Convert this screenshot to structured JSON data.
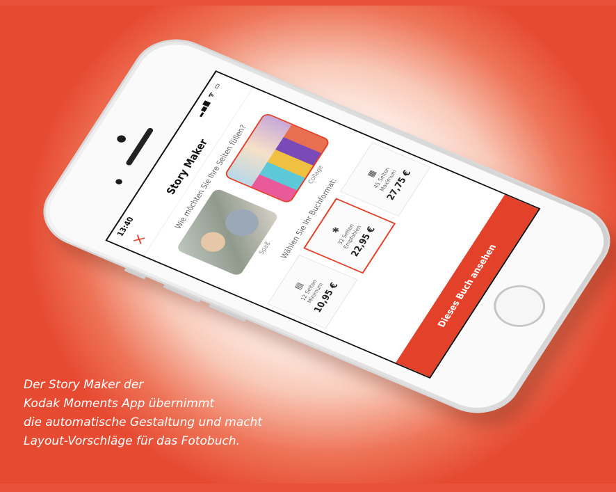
{
  "phone": {
    "status_time": "13:40",
    "status_icons": "▂▄▆ ᯤ ▭",
    "nav_title": "Story Maker",
    "close_icon": "×",
    "question": "Wie möchten Sie Ihre Seiten füllen?",
    "layouts": [
      {
        "label": "Spaß"
      },
      {
        "label": "Collage"
      }
    ],
    "format_question": "Wählen Sie Ihr Buchformat:",
    "formats": [
      {
        "desc_line1": "12 Seiten",
        "desc_line2": "Minimum",
        "price": "10,95 €",
        "selected": false
      },
      {
        "desc_line1": "32 Seiten",
        "desc_line2": "Empfohlen",
        "price": "22,95 €",
        "selected": true
      },
      {
        "desc_line1": "45 Seiten",
        "desc_line2": "Maximum",
        "price": "27,75 €",
        "selected": false
      }
    ],
    "cta_label": "Dieses Buch ansehen"
  },
  "caption": {
    "line1": "Der Story Maker der",
    "line2": "Kodak Moments App übernimmt",
    "line3": "die automatische Gestaltung und macht",
    "line4": "Layout-Vorschläge für das Fotobuch."
  },
  "colors": {
    "accent": "#e3412a",
    "background": "#e8503a"
  }
}
